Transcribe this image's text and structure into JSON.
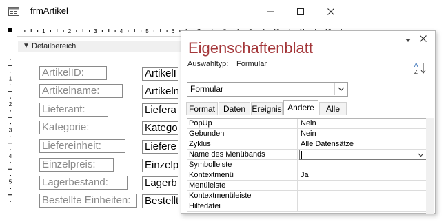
{
  "window": {
    "title": "frmArtikel",
    "icon": "form-icon",
    "minimize_icon": "minimize-icon",
    "maximize_icon": "maximize-icon",
    "close_icon": "close-icon"
  },
  "ruler": {
    "h_ticks": [
      "1",
      "2",
      "3",
      "4",
      "5",
      "6",
      "7",
      "8",
      "9",
      "10",
      "11",
      "12",
      "13"
    ],
    "v_ticks": [
      "1",
      "2",
      "3",
      "4",
      "5"
    ]
  },
  "section": {
    "label": "Detailbereich",
    "icon": "collapse-arrow-icon"
  },
  "form_controls": [
    {
      "label": "ArtikelID:",
      "field": "ArtikelI"
    },
    {
      "label": "Artikelname:",
      "field": "Artikeln"
    },
    {
      "label": "Lieferant:",
      "field": "Liefera"
    },
    {
      "label": "Kategorie:",
      "field": "Katego"
    },
    {
      "label": "Liefereinheit:",
      "field": "Liefere"
    },
    {
      "label": "Einzelpreis:",
      "field": "Einzelpr"
    },
    {
      "label": "Lagerbestand:",
      "field": "Lagerb"
    },
    {
      "label": "Bestellte Einheiten:",
      "field": "Bestellt"
    }
  ],
  "property_sheet": {
    "title": "Eigenschaftenblatt",
    "selection_type_label": "Auswahltyp:",
    "selection_type_value": "Formular",
    "dropdown_value": "Formular",
    "pin_icon": "dropdown-arrow-icon",
    "close_icon": "close-icon",
    "sort_icon": "sort-az-icon",
    "tabs": [
      {
        "label": "Format",
        "active": false
      },
      {
        "label": "Daten",
        "active": false
      },
      {
        "label": "Ereignis",
        "active": false
      },
      {
        "label": "Andere",
        "active": true
      },
      {
        "label": "Alle",
        "active": false
      }
    ],
    "rows": [
      {
        "name": "PopUp",
        "value": "Nein"
      },
      {
        "name": "Gebunden",
        "value": "Nein"
      },
      {
        "name": "Zyklus",
        "value": "Alle Datensätze"
      },
      {
        "name": "Name des Menübands",
        "value": ""
      },
      {
        "name": "Symbolleiste",
        "value": ""
      },
      {
        "name": "Kontextmenü",
        "value": "Ja"
      },
      {
        "name": "Menüleiste",
        "value": ""
      },
      {
        "name": "Kontextmenüleiste",
        "value": ""
      },
      {
        "name": "Hilfedatei",
        "value": ""
      }
    ]
  },
  "colors": {
    "window_border": "#c42b1c",
    "sheet_title": "#a4373a",
    "label_text": "#8a8a8a"
  }
}
